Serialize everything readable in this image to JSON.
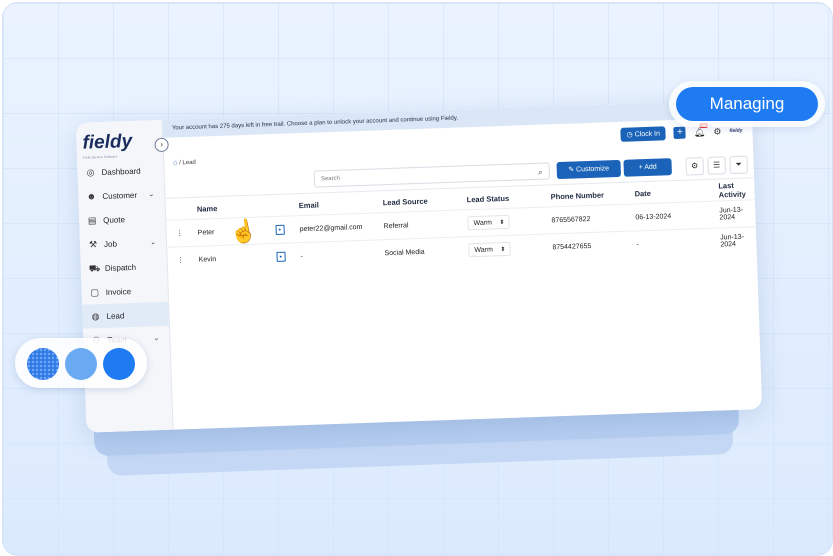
{
  "app": {
    "logo_text": "fieldy",
    "logo_tagline": "Field Service Software"
  },
  "banner": {
    "text": "Your account has 275 days left in free trail. Choose a plan to unlock your account and continue using Fieldy."
  },
  "topbar": {
    "clock_in_label": "Clock In",
    "notification_count": "24",
    "mini_logo": "fieldy"
  },
  "breadcrumb": {
    "text": "/ Lead"
  },
  "sidebar": {
    "items": [
      {
        "label": "Dashboard",
        "icon": "dashboard-icon"
      },
      {
        "label": "Customer",
        "icon": "customer-icon",
        "expandable": true
      },
      {
        "label": "Quote",
        "icon": "quote-icon"
      },
      {
        "label": "Job",
        "icon": "job-icon",
        "expandable": true
      },
      {
        "label": "Dispatch",
        "icon": "dispatch-icon"
      },
      {
        "label": "Invoice",
        "icon": "invoice-icon"
      },
      {
        "label": "Lead",
        "icon": "lead-icon",
        "active": true
      },
      {
        "label": "Team",
        "icon": "team-icon",
        "expandable": true
      }
    ]
  },
  "toolbar": {
    "search_placeholder": "Search",
    "customize_label": "Customize",
    "add_label": "Add"
  },
  "table": {
    "columns": [
      "Name",
      "Email",
      "Lead Source",
      "Lead Status",
      "Phone Number",
      "Date",
      "Last Activity"
    ],
    "rows": [
      {
        "name": "Peter",
        "email": "peter22@gmail.com",
        "source": "Referral",
        "status": "Warm",
        "phone": "8765567822",
        "date": "06-13-2024",
        "last_activity": "Jun-13-2024"
      },
      {
        "name": "Kevin",
        "email": "-",
        "source": "Social Media",
        "status": "Warm",
        "phone": "8754427655",
        "date": "-",
        "last_activity": "Jun-13-2024"
      }
    ]
  },
  "pill": {
    "label": "Managing"
  },
  "colors": {
    "accent": "#1e7bf2",
    "primary_button": "#1a63b8",
    "swatches": [
      "#2f7ae5",
      "#6aaaf2",
      "#1e7bf2"
    ]
  }
}
